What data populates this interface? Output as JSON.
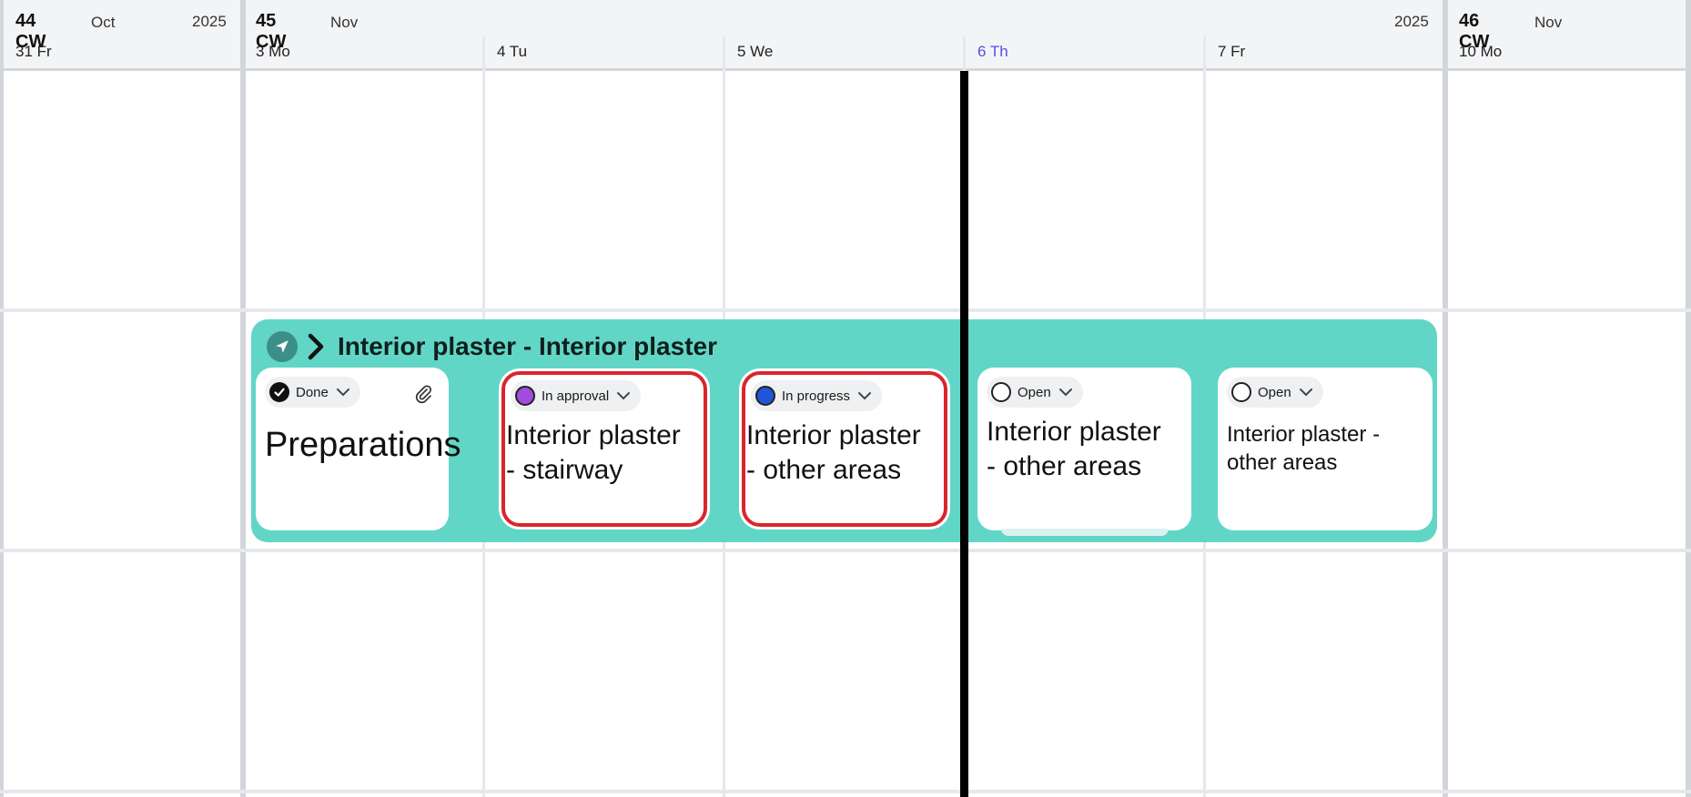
{
  "header": {
    "weeks": [
      {
        "week": "44 CW",
        "month": "Oct",
        "year": "2025"
      },
      {
        "week": "45 CW",
        "month": "Nov",
        "year": "2025"
      },
      {
        "week": "46 CW",
        "month": "Nov"
      }
    ],
    "days": [
      "31 Fr",
      "3 Mo",
      "4 Tu",
      "5 We",
      "6 Th",
      "7 Fr",
      "10 Mo"
    ],
    "today": "6 Th"
  },
  "group": {
    "title": "Interior plaster - Interior plaster",
    "icon": "navigation-arrow-icon",
    "expand_icon": "chevron-right-icon"
  },
  "tasks": [
    {
      "status": "Done",
      "status_color": "#111111",
      "title": "Preparations",
      "attachment_icon": "paperclip-icon",
      "highlighted": false
    },
    {
      "status": "In approval",
      "status_color": "#a24bdf",
      "title": "Interior plaster\n- stairway",
      "highlighted": true,
      "highlight_color": "#d9262b"
    },
    {
      "status": "In progress",
      "status_color": "#1f55d6",
      "title": "Interior plaster\n- other areas",
      "highlighted": true,
      "highlight_color": "#d9262b"
    },
    {
      "status": "Open",
      "status_color": "#ffffff",
      "title": "Interior plaster\n- other areas",
      "highlighted": false
    },
    {
      "status": "Open",
      "status_color": "#ffffff",
      "title": "Interior plaster  -\nother areas",
      "highlighted": false
    }
  ],
  "colors": {
    "group_bg": "#62d6c6",
    "today_text": "#5a4fe0",
    "today_line": "#000000"
  }
}
